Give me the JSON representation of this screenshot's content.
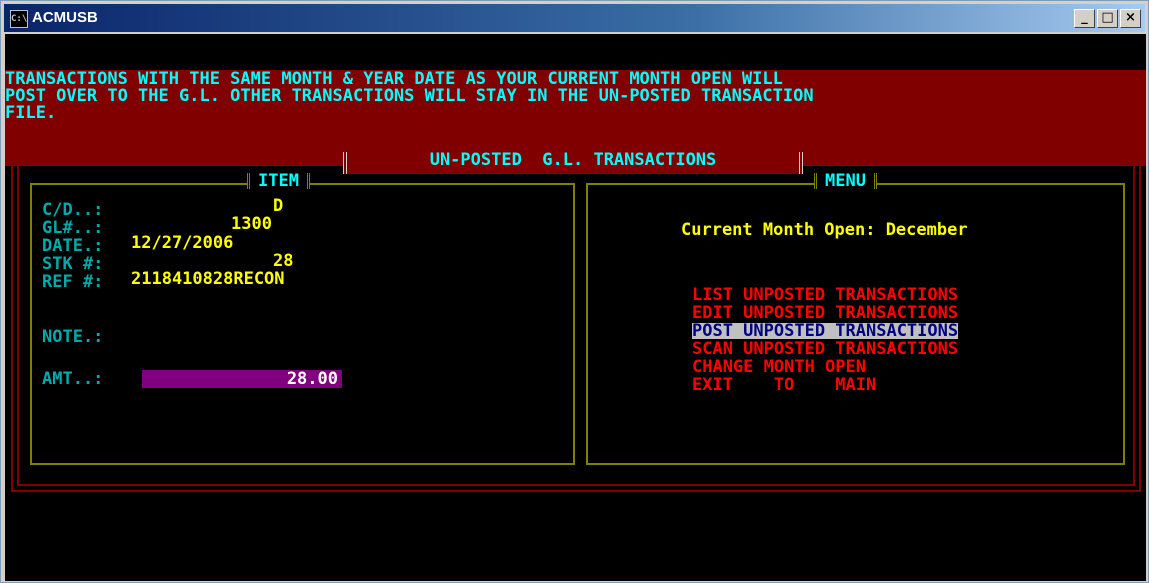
{
  "window": {
    "title": "ACMUSB",
    "icon_text": "C:\\",
    "minimize": "_",
    "maximize": "□",
    "close": "×"
  },
  "banner": {
    "line1": "TRANSACTIONS WITH THE SAME MONTH & YEAR DATE AS YOUR CURRENT MONTH OPEN WILL",
    "line2": "POST OVER TO THE G.L. OTHER TRANSACTIONS WILL STAY IN THE UN-POSTED TRANSACTION",
    "line3": "FILE."
  },
  "frame_title": "UN-POSTED  G.L. TRANSACTIONS",
  "item_panel": {
    "heading": "ITEM",
    "cd_label": "C/D..:",
    "cd_value": "D",
    "gl_label": "GL#..:",
    "gl_value": "1300",
    "date_label": "DATE.:",
    "date_value": "12/27/2006",
    "stk_label": "STK #:",
    "stk_value": "28",
    "ref_label": "REF #:",
    "ref_value": "2118410828RECON",
    "note_label": "NOTE.:",
    "amt_label": "AMT..:",
    "amt_value": "28.00"
  },
  "menu_panel": {
    "heading": "MENU",
    "current_month": "Current Month Open: December",
    "items": [
      {
        "label": "LIST UNPOSTED TRANSACTIONS",
        "selected": false
      },
      {
        "label": "EDIT UNPOSTED TRANSACTIONS",
        "selected": false
      },
      {
        "label": "POST UNPOSTED TRANSACTIONS",
        "selected": true
      },
      {
        "label": "SCAN UNPOSTED TRANSACTIONS",
        "selected": false
      },
      {
        "label": "CHANGE MONTH OPEN",
        "selected": false
      },
      {
        "label": "EXIT    TO    MAIN",
        "selected": false
      }
    ]
  },
  "colors": {
    "banner_bg": "#800000",
    "banner_text": "#00ffff",
    "label": "#00aaaa",
    "value": "#ffff00",
    "menu_item": "#ff0000",
    "selected_bg": "#c0c0c0",
    "selected_text": "#000080",
    "amount_bg": "#800080"
  }
}
